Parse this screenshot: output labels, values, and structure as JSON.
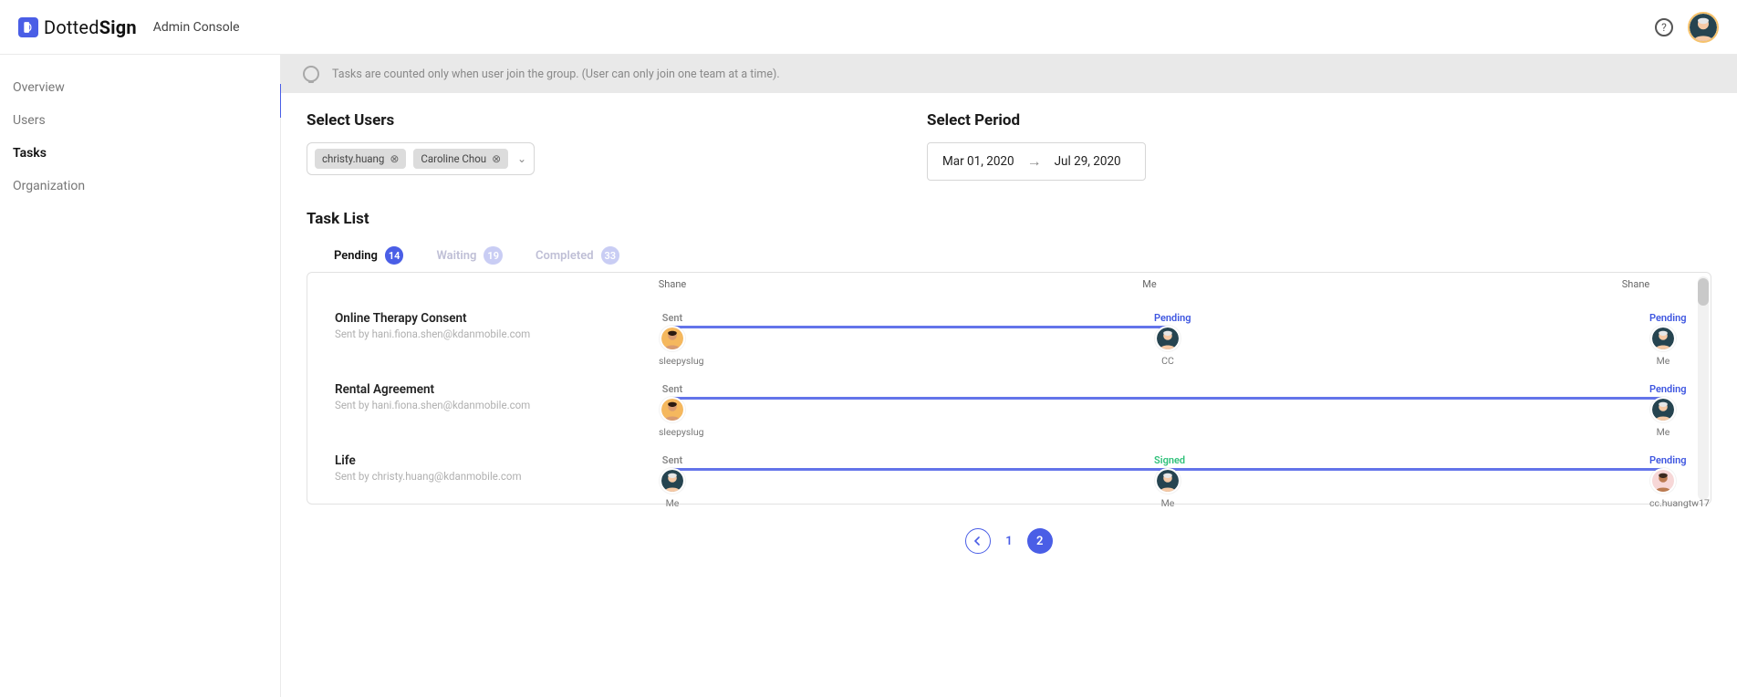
{
  "header": {
    "brand_dotted": "Dotted",
    "brand_sign": "Sign",
    "subtitle": "Admin Console",
    "help_symbol": "?"
  },
  "sidebar": {
    "items": [
      {
        "label": "Overview"
      },
      {
        "label": "Users"
      },
      {
        "label": "Tasks"
      },
      {
        "label": "Organization"
      }
    ],
    "active_index": 2
  },
  "info_banner": "Tasks are counted only when user join the group. (User can only join one team at a time).",
  "filters": {
    "users": {
      "title": "Select Users",
      "chips": [
        "christy.huang",
        "Caroline Chou"
      ]
    },
    "period": {
      "title": "Select Period",
      "from": "Mar 01, 2020",
      "to": "Jul 29, 2020"
    }
  },
  "task_list": {
    "title": "Task List",
    "tabs": [
      {
        "label": "Pending",
        "count": "14",
        "active": true
      },
      {
        "label": "Waiting",
        "count": "19",
        "active": false
      },
      {
        "label": "Completed",
        "count": "33",
        "active": false
      }
    ],
    "top_context": {
      "left": "Shane",
      "mid": "Me",
      "right": "Shane"
    },
    "rows": [
      {
        "title": "Online Therapy Consent",
        "sub": "Sent by hani.fiona.shen@kdanmobile.com",
        "nodes": [
          {
            "pos": 0,
            "status": "Sent",
            "status_class": "st-sent",
            "who": "sleepyslug",
            "avatar": "f_brown"
          },
          {
            "pos": 50,
            "status": "Pending",
            "status_class": "st-pending",
            "who": "CC",
            "avatar": "m_grey"
          },
          {
            "pos": 100,
            "status": "Pending",
            "status_class": "st-pending",
            "who": "Me",
            "avatar": "m_grey"
          }
        ],
        "line_from": 0,
        "line_to": 50
      },
      {
        "title": "Rental Agreement",
        "sub": "Sent by hani.fiona.shen@kdanmobile.com",
        "nodes": [
          {
            "pos": 0,
            "status": "Sent",
            "status_class": "st-sent",
            "who": "sleepyslug",
            "avatar": "f_brown"
          },
          {
            "pos": 100,
            "status": "Pending",
            "status_class": "st-pending",
            "who": "Me",
            "avatar": "m_grey"
          }
        ],
        "line_from": 0,
        "line_to": 100
      },
      {
        "title": "Life",
        "sub": "Sent by christy.huang@kdanmobile.com",
        "nodes": [
          {
            "pos": 0,
            "status": "Sent",
            "status_class": "st-sent",
            "who": "Me",
            "avatar": "m_grey"
          },
          {
            "pos": 50,
            "status": "Signed",
            "status_class": "st-signed",
            "who": "Me",
            "avatar": "m_grey"
          },
          {
            "pos": 100,
            "status": "Pending",
            "status_class": "st-pending",
            "who": "cc.huangtw17",
            "avatar": "f_pink"
          }
        ],
        "line_from": 0,
        "line_to": 100
      }
    ]
  },
  "pagination": {
    "current": 2,
    "pages": [
      1,
      2
    ]
  },
  "avatars": {
    "m_grey": {
      "bg": "#264450",
      "hair": "#e6e6e6",
      "skin": "#f6c9a5"
    },
    "f_brown": {
      "bg": "#f5b85e",
      "hair": "#2b1a10",
      "skin": "#d99b70"
    },
    "f_pink": {
      "bg": "#f7d7d7",
      "hair": "#3b2a1f",
      "skin": "#bb7a50"
    }
  }
}
